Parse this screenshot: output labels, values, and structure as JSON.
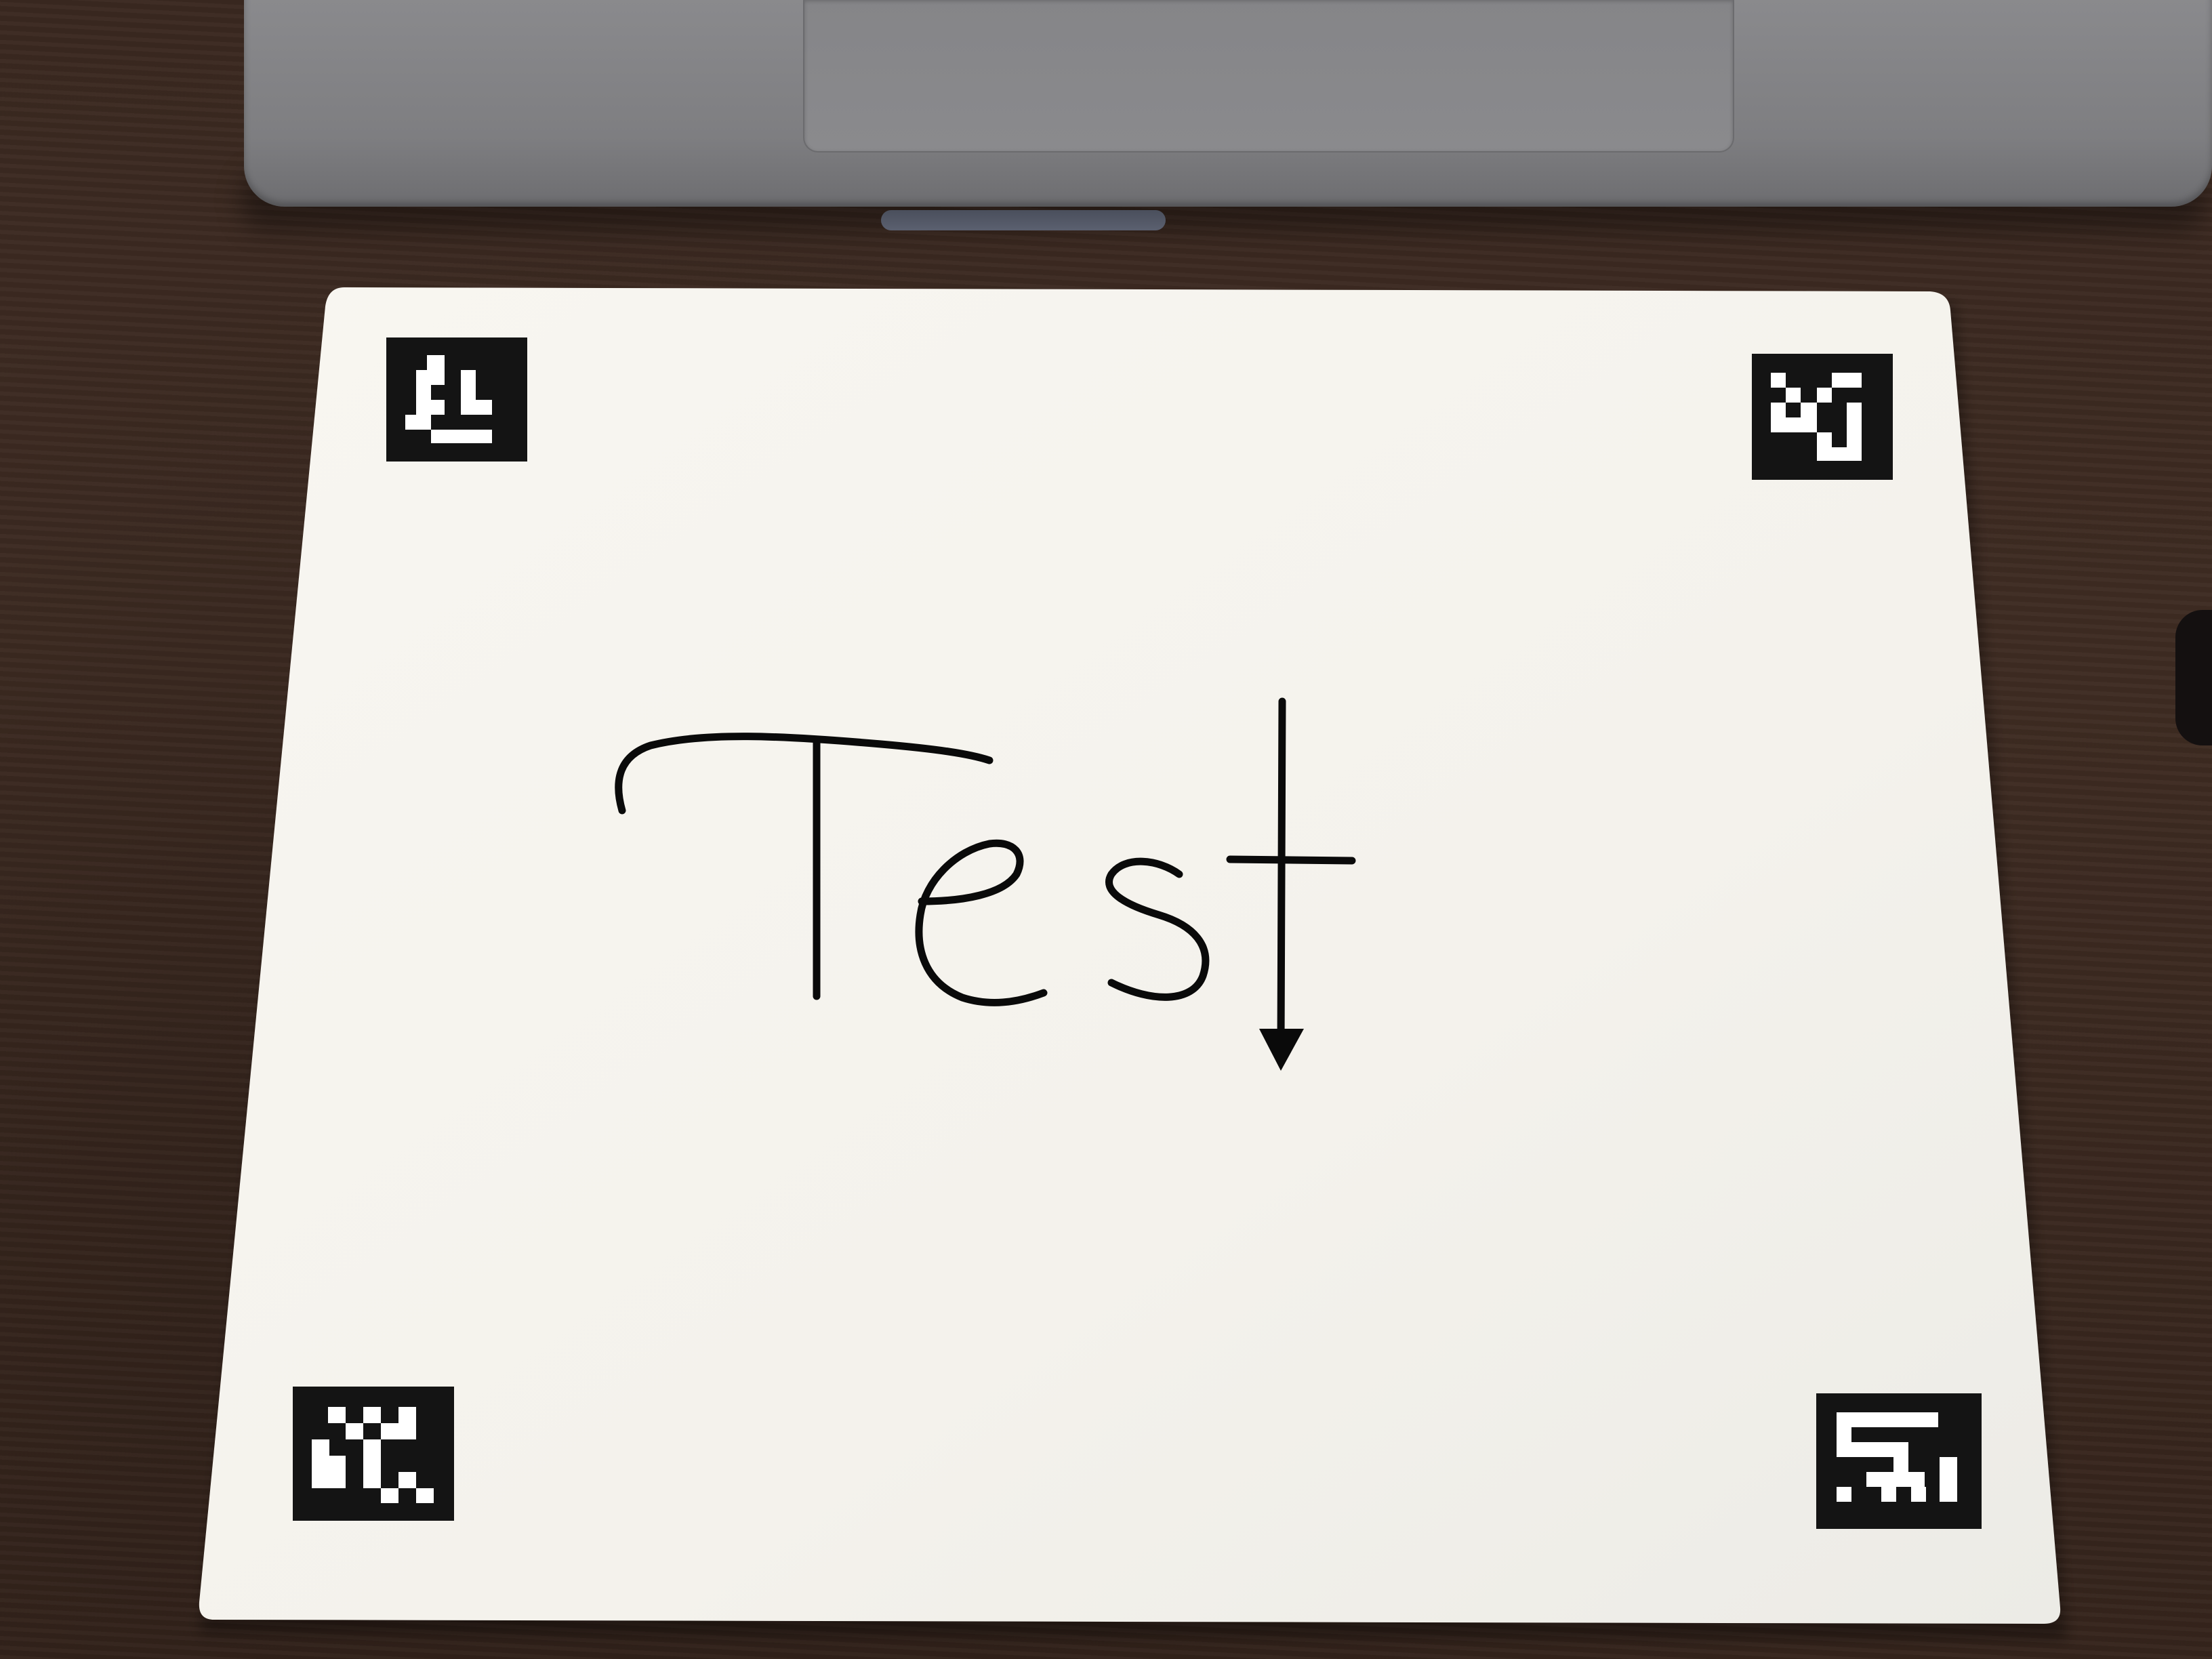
{
  "scene": {
    "description_items": [
      "wooden-desk",
      "laptop",
      "paper-sheet",
      "fiducial-markers",
      "handwritten-text"
    ]
  },
  "paper": {
    "handwritten_text": "Test",
    "markers": [
      "marker-top-left",
      "marker-top-right",
      "marker-bottom-left",
      "marker-bottom-right"
    ]
  },
  "colors": {
    "wood": "#3a2820",
    "laptop": "#7e7e81",
    "paper": "#f7f5f0",
    "ink": "#0a0a0a"
  }
}
